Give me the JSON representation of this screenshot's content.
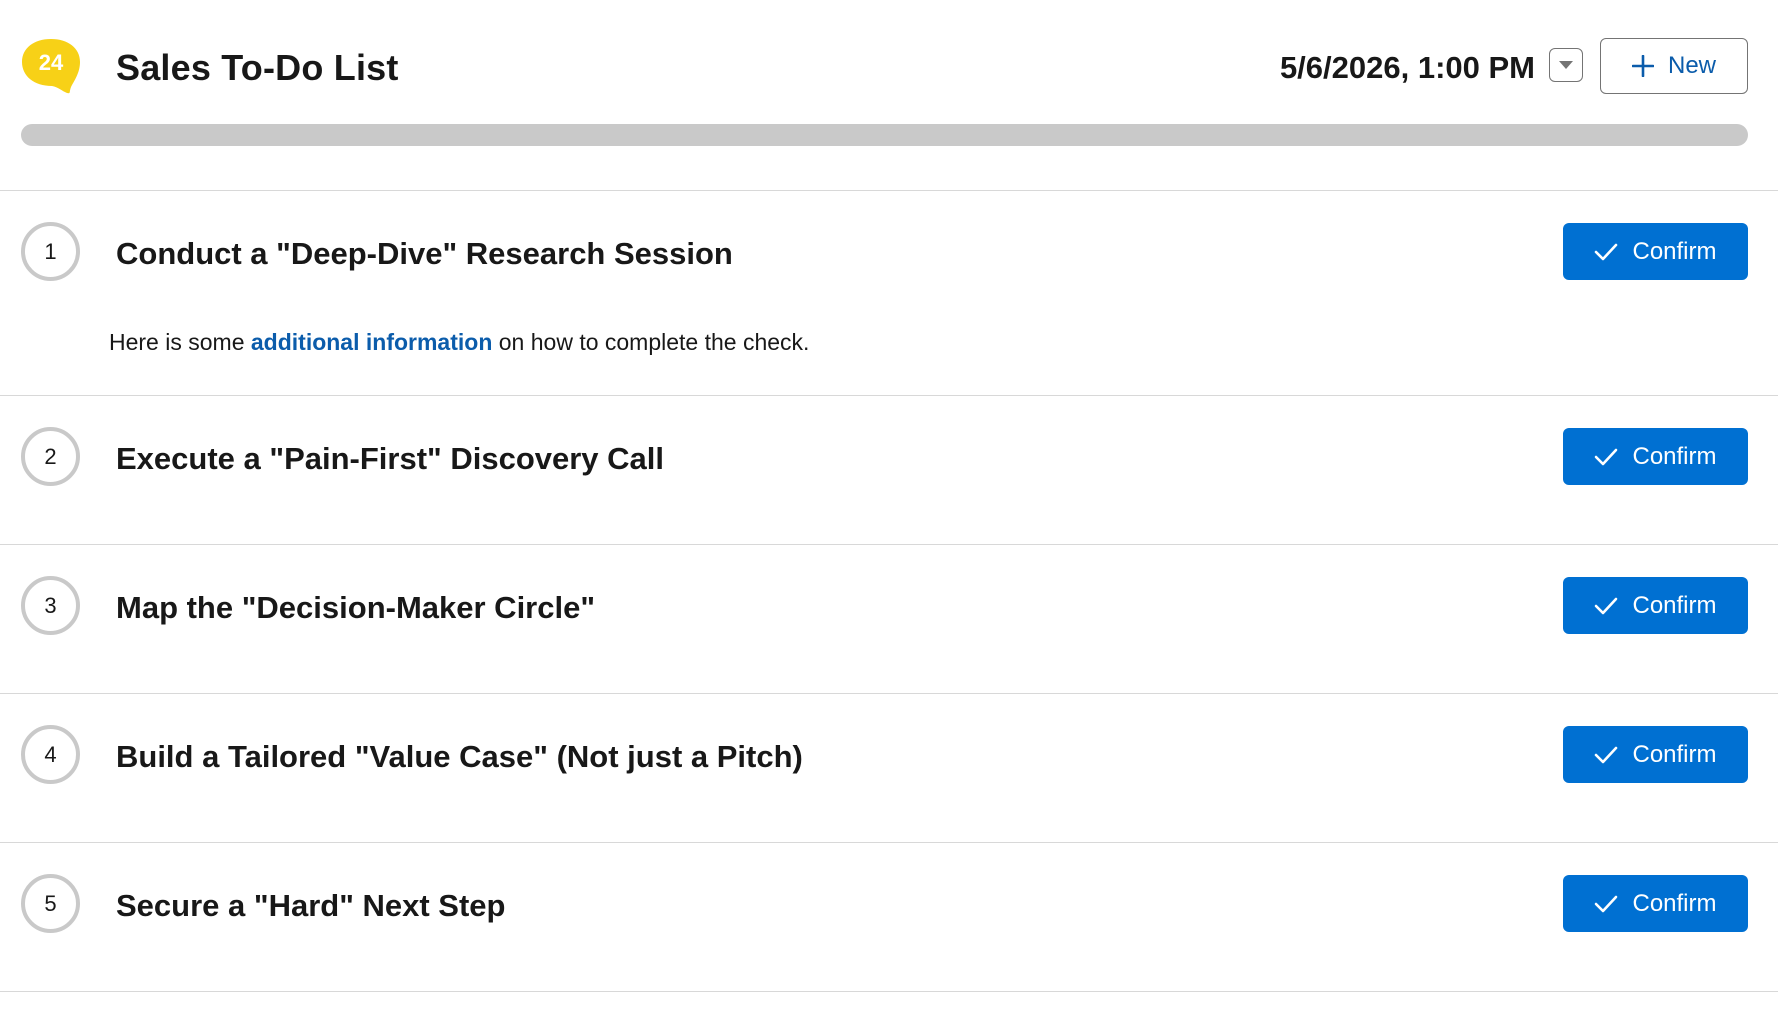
{
  "header": {
    "logo_text": "24",
    "title": "Sales To-Do List",
    "datetime": "5/6/2026, 1:00 PM",
    "dropdown_icon": "caret-down-icon",
    "new_button_label": "New",
    "new_button_icon": "plus-icon",
    "progress_fraction": 0
  },
  "colors": {
    "logo": "#f7d117",
    "accent": "#0070d2",
    "link": "#0b5cab",
    "progress_track": "#c9c9c9"
  },
  "tasks": [
    {
      "number": "1",
      "title": "Conduct a \"Deep-Dive\" Research Session",
      "desc_before": "Here is some ",
      "desc_link": "additional information",
      "desc_after": " on how to complete the check.",
      "confirm_label": "Confirm"
    },
    {
      "number": "2",
      "title": "Execute a \"Pain-First\" Discovery Call",
      "confirm_label": "Confirm"
    },
    {
      "number": "3",
      "title": "Map the \"Decision-Maker Circle\"",
      "confirm_label": "Confirm"
    },
    {
      "number": "4",
      "title": "Build a Tailored \"Value Case\" (Not just a Pitch)",
      "confirm_label": "Confirm"
    },
    {
      "number": "5",
      "title": "Secure a \"Hard\" Next Step",
      "confirm_label": "Confirm"
    }
  ]
}
